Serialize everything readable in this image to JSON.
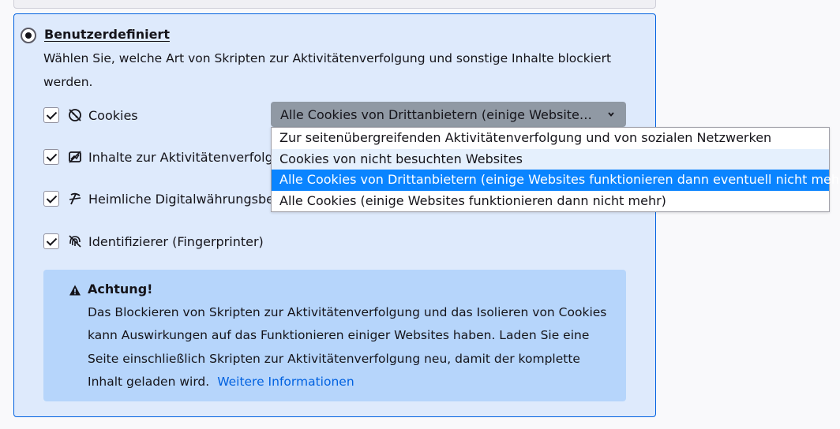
{
  "section": {
    "title": "Benutzerdefiniert",
    "description": "Wählen Sie, welche Art von Skripten zur Aktivitätenverfolgung und sonstige Inhalte blockiert werden."
  },
  "options": [
    {
      "label": "Cookies",
      "checked": true,
      "icon": "cookie-icon"
    },
    {
      "label": "Inhalte zur Aktivitätenverfolgung",
      "checked": true,
      "icon": "tracking-content-icon"
    },
    {
      "label": "Heimliche Digitalwährungsberechner (Krypto-Miner)",
      "checked": true,
      "icon": "cryptominer-icon"
    },
    {
      "label": "Identifizierer (Fingerprinter)",
      "checked": true,
      "icon": "fingerprinter-icon"
    }
  ],
  "cookie_select": {
    "selected_label": "Alle Cookies von Drittanbietern (einige Websites funktionieren dann eventuell nicht mehr)",
    "options": [
      "Zur seitenübergreifenden Aktivitätenverfolgung und von sozialen Netzwerken",
      "Cookies von nicht besuchten Websites",
      "Alle Cookies von Drittanbietern (einige Websites funktionieren dann eventuell nicht mehr)",
      "Alle Cookies (einige Websites funktionieren dann nicht mehr)"
    ],
    "selected_index": 2,
    "hover_index": 1
  },
  "warning": {
    "title": "Achtung!",
    "body": "Das Blockieren von Skripten zur Aktivitätenverfolgung und das Isolieren von Cookies kann Auswirkungen auf das Funktionieren einiger Websites haben. Laden Sie eine Seite einschließlich Skripten zur Aktivitätenverfolgung neu, damit der komplette Inhalt geladen wird.",
    "link": "Weitere Informationen"
  },
  "colors": {
    "accent": "#0061e0",
    "panel_bg": "#deeafc",
    "warning_bg": "#b6d5fb",
    "selected_option_bg": "#0a84ff"
  }
}
